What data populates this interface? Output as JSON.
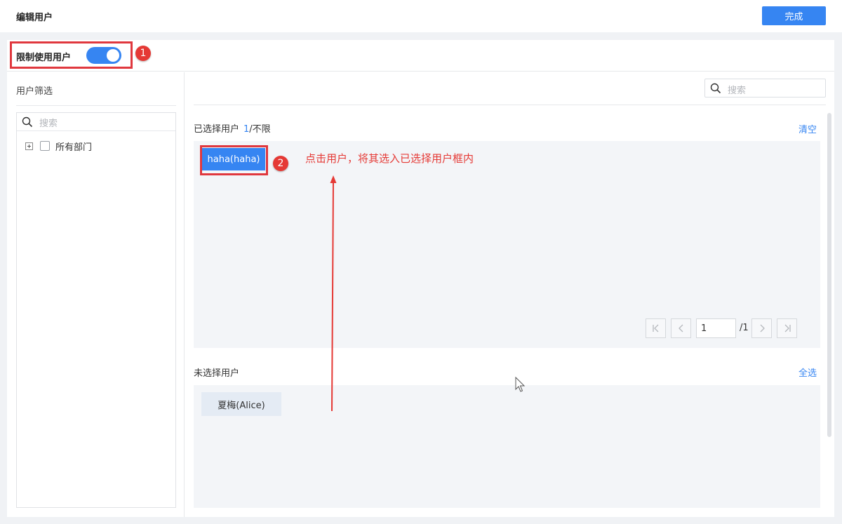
{
  "header": {
    "title": "编辑用户",
    "done_label": "完成"
  },
  "restrict": {
    "label": "限制使用用户",
    "enabled": true
  },
  "annotations": {
    "badge1": "1",
    "badge2": "2",
    "hint": "点击用户，将其选入已选择用户框内"
  },
  "filter": {
    "title": "用户筛选",
    "search_placeholder": "搜索",
    "tree": [
      {
        "label": "所有部门",
        "checked": false,
        "expandable": true
      }
    ]
  },
  "users": {
    "search_placeholder": "搜索",
    "selected": {
      "title": "已选择用户",
      "count_current": "1",
      "count_limit": "/不限",
      "clear_label": "清空",
      "items": [
        "haha(haha)"
      ]
    },
    "pagination": {
      "first_icon": "first-page-icon",
      "prev_icon": "prev-page-icon",
      "page_value": "1",
      "total": "/1",
      "next_icon": "next-page-icon",
      "last_icon": "last-page-icon"
    },
    "unselected": {
      "title": "未选择用户",
      "select_all_label": "全选",
      "items": [
        "夏梅(Alice)"
      ]
    }
  },
  "colors": {
    "accent": "#3685f2",
    "annotation_red": "#e53935"
  }
}
